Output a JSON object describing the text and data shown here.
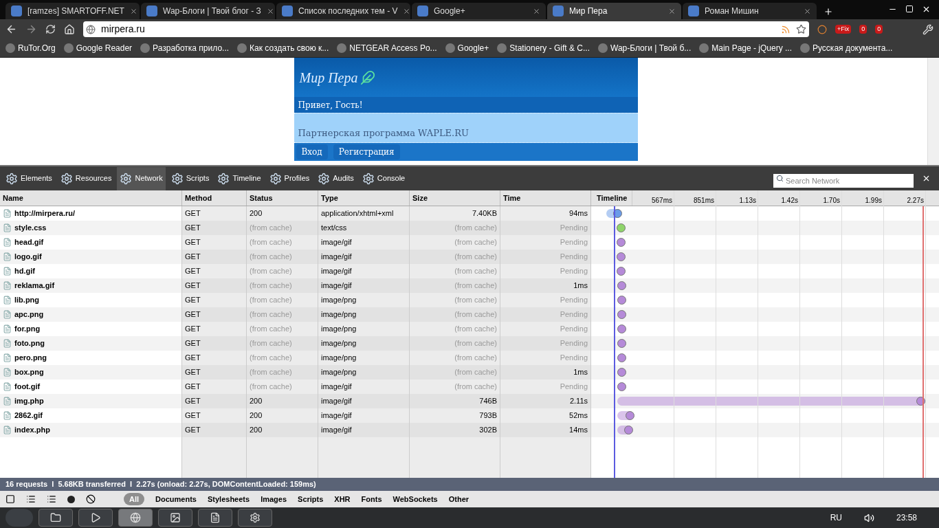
{
  "browser_tabs": [
    {
      "title": "[ramzes] SMARTOFF.NET",
      "selected": false
    },
    {
      "title": "Wap-Блоги | Твой блог - З",
      "selected": false
    },
    {
      "title": "Список последних тем - V",
      "selected": false
    },
    {
      "title": "Google+",
      "selected": false
    },
    {
      "title": "Мир Пера",
      "selected": true
    },
    {
      "title": "Роман Мишин",
      "selected": false
    }
  ],
  "address": {
    "value": "mirpera.ru"
  },
  "extension_badges": [
    "+Fix",
    "0",
    "0"
  ],
  "bookmarks": [
    "RuTor.Org",
    "Google Reader",
    "Разработка прило...",
    "Как создать свою к...",
    "NETGEAR Access Po...",
    "Google+",
    "Stationery - Gift & C...",
    "Wap-Блоги | Твой б...",
    "Main Page - jQuery ...",
    "Русская документа..."
  ],
  "page": {
    "logo": "Мир Пера",
    "greeting": "Привет, Гость!",
    "partner_link": "Партнерская программа WAPLE.RU",
    "nav": [
      "Вход",
      "Регистрация"
    ]
  },
  "devtools_tabs": [
    {
      "label": "Elements",
      "selected": false
    },
    {
      "label": "Resources",
      "selected": false
    },
    {
      "label": "Network",
      "selected": true
    },
    {
      "label": "Scripts",
      "selected": false
    },
    {
      "label": "Timeline",
      "selected": false
    },
    {
      "label": "Profiles",
      "selected": false
    },
    {
      "label": "Audits",
      "selected": false
    },
    {
      "label": "Console",
      "selected": false
    }
  ],
  "search": {
    "placeholder": "Search Network"
  },
  "table": {
    "columns": [
      "Name",
      "Method",
      "Status",
      "Type",
      "Size",
      "Time",
      "Timeline"
    ],
    "ticks": [
      "567ms",
      "851ms",
      "1.13s",
      "1.42s",
      "1.70s",
      "1.99s",
      "2.27s"
    ],
    "dom_content_loaded_line": {
      "level": 0.067
    },
    "load_line": {
      "level": 0.985
    },
    "rows": [
      {
        "name": "http://mirpera.ru/",
        "method": "GET",
        "status": "200",
        "type": "application/xhtml+xml",
        "size": "7.40KB",
        "time": "94ms",
        "cached": false,
        "color": "#6a9be8",
        "level": 0.078
      },
      {
        "name": "style.css",
        "method": "GET",
        "status": "(from cache)",
        "type": "text/css",
        "size": "(from cache)",
        "time": "Pending",
        "cached": true,
        "color": "#8fd46a",
        "level": 0.088
      },
      {
        "name": "head.gif",
        "method": "GET",
        "status": "(from cache)",
        "type": "image/gif",
        "size": "(from cache)",
        "time": "Pending",
        "cached": true,
        "color": "#b58ad8",
        "level": 0.088
      },
      {
        "name": "logo.gif",
        "method": "GET",
        "status": "(from cache)",
        "type": "image/gif",
        "size": "(from cache)",
        "time": "Pending",
        "cached": true,
        "color": "#b58ad8",
        "level": 0.088
      },
      {
        "name": "hd.gif",
        "method": "GET",
        "status": "(from cache)",
        "type": "image/gif",
        "size": "(from cache)",
        "time": "Pending",
        "cached": true,
        "color": "#b58ad8",
        "level": 0.088
      },
      {
        "name": "reklama.gif",
        "method": "GET",
        "status": "(from cache)",
        "type": "image/gif",
        "size": "(from cache)",
        "time": "1ms",
        "cached": true,
        "color": "#b58ad8",
        "level": 0.089
      },
      {
        "name": "lib.png",
        "method": "GET",
        "status": "(from cache)",
        "type": "image/png",
        "size": "(from cache)",
        "time": "Pending",
        "cached": true,
        "color": "#b58ad8",
        "level": 0.089
      },
      {
        "name": "apc.png",
        "method": "GET",
        "status": "(from cache)",
        "type": "image/png",
        "size": "(from cache)",
        "time": "Pending",
        "cached": true,
        "color": "#b58ad8",
        "level": 0.089
      },
      {
        "name": "for.png",
        "method": "GET",
        "status": "(from cache)",
        "type": "image/png",
        "size": "(from cache)",
        "time": "Pending",
        "cached": true,
        "color": "#b58ad8",
        "level": 0.089
      },
      {
        "name": "foto.png",
        "method": "GET",
        "status": "(from cache)",
        "type": "image/png",
        "size": "(from cache)",
        "time": "Pending",
        "cached": true,
        "color": "#b58ad8",
        "level": 0.089
      },
      {
        "name": "pero.png",
        "method": "GET",
        "status": "(from cache)",
        "type": "image/png",
        "size": "(from cache)",
        "time": "Pending",
        "cached": true,
        "color": "#b58ad8",
        "level": 0.089
      },
      {
        "name": "box.png",
        "method": "GET",
        "status": "(from cache)",
        "type": "image/png",
        "size": "(from cache)",
        "time": "1ms",
        "cached": true,
        "color": "#b58ad8",
        "level": 0.089
      },
      {
        "name": "foot.gif",
        "method": "GET",
        "status": "(from cache)",
        "type": "image/gif",
        "size": "(from cache)",
        "time": "Pending",
        "cached": true,
        "color": "#b58ad8",
        "level": 0.089
      },
      {
        "name": "img.php",
        "method": "GET",
        "status": "200",
        "type": "image/gif",
        "size": "746B",
        "time": "2.11s",
        "cached": false,
        "color": "#b58ad8",
        "level": 0.978
      },
      {
        "name": "2862.gif",
        "method": "GET",
        "status": "200",
        "type": "image/gif",
        "size": "793B",
        "time": "52ms",
        "cached": false,
        "color": "#b58ad8",
        "level": 0.114
      },
      {
        "name": "index.php",
        "method": "GET",
        "status": "200",
        "type": "image/gif",
        "size": "302B",
        "time": "14ms",
        "cached": false,
        "color": "#b58ad8",
        "level": 0.11
      }
    ]
  },
  "status_bar": "16 requests  I  5.68KB transferred  I  2.27s (onload: 2.27s, DOMContentLoaded: 159ms)",
  "filters": [
    {
      "label": "All",
      "selected": true
    },
    {
      "label": "Documents",
      "selected": false
    },
    {
      "label": "Stylesheets",
      "selected": false
    },
    {
      "label": "Images",
      "selected": false
    },
    {
      "label": "Scripts",
      "selected": false
    },
    {
      "label": "XHR",
      "selected": false
    },
    {
      "label": "Fonts",
      "selected": false
    },
    {
      "label": "WebSockets",
      "selected": false
    },
    {
      "label": "Other",
      "selected": false
    }
  ],
  "taskbar": {
    "language": "RU",
    "time": "23:58"
  }
}
